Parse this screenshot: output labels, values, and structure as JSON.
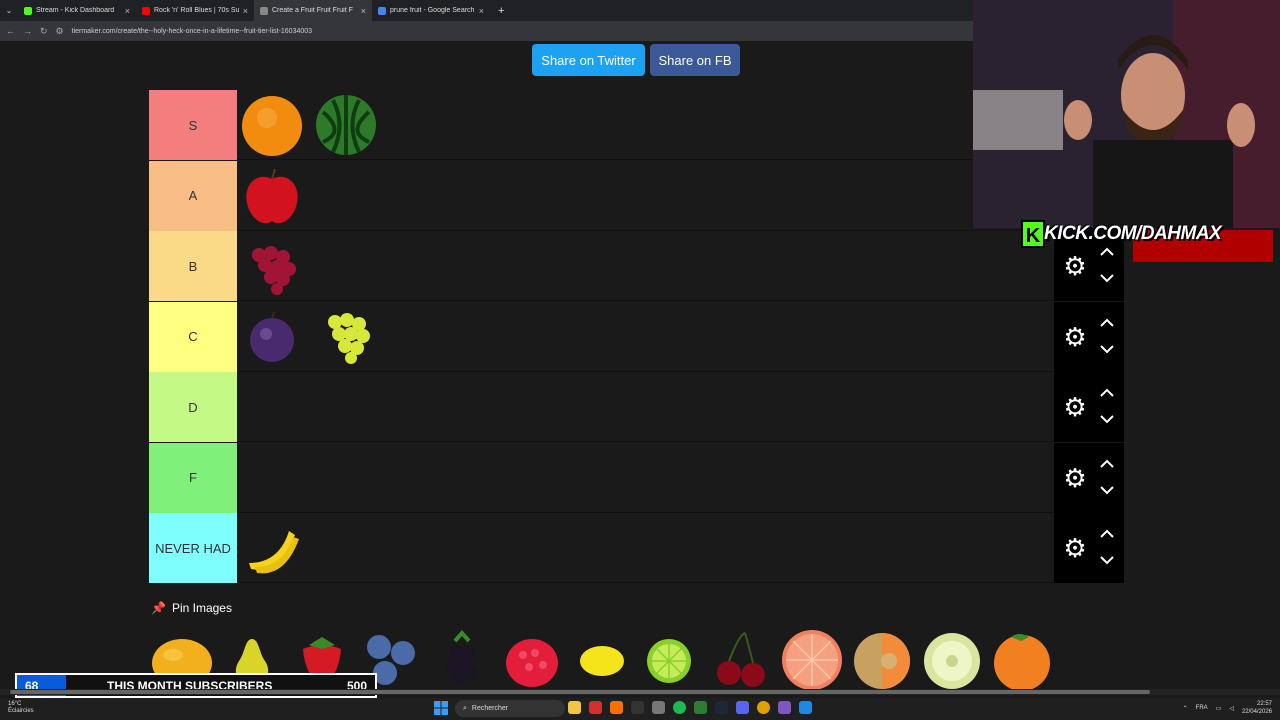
{
  "browser": {
    "tabs": [
      {
        "title": "Stream - Kick Dashboard",
        "color": "#53fc18",
        "active": false
      },
      {
        "title": "Rock 'n' Roll Blues | 70s Sun",
        "color": "#ff0000",
        "active": false
      },
      {
        "title": "Create a Fruit Fruit Fruit F",
        "color": "#888888",
        "active": true
      },
      {
        "title": "prune fruit - Google Search",
        "color": "#4285f4",
        "active": false
      }
    ],
    "url": "tiermaker.com/create/the--holy-heck-once-in-a-lifetime--fruit-tier-list-16034003"
  },
  "share": {
    "twitter": "Share on Twitter",
    "fb": "Share on FB"
  },
  "tiers": [
    {
      "label": "S",
      "color": "#f47e7e",
      "items": [
        "orange",
        "watermelon"
      ]
    },
    {
      "label": "A",
      "color": "#f8be86",
      "items": [
        "apple"
      ]
    },
    {
      "label": "B",
      "color": "#fad987",
      "items": [
        "red-grapes"
      ]
    },
    {
      "label": "C",
      "color": "#fefe81",
      "items": [
        "plum",
        "green-grapes"
      ]
    },
    {
      "label": "D",
      "color": "#c4f986",
      "items": []
    },
    {
      "label": "F",
      "color": "#7ff17b",
      "items": []
    },
    {
      "label": "NEVER HAD",
      "color": "#7ffefe",
      "items": [
        "banana"
      ]
    }
  ],
  "pin_label": "Pin Images",
  "pool": [
    "mango",
    "pear",
    "strawberry",
    "blueberries",
    "blackberry",
    "raspberry",
    "lemon",
    "lime",
    "cherries",
    "grapefruit",
    "cantaloupe",
    "honeydew",
    "tangerine"
  ],
  "stream": {
    "kick_text": "KICK.COM/DAHMAX"
  },
  "subs": {
    "current": "68",
    "label": "THIS MONTH SUBSCRIBERS",
    "goal": "500",
    "progress": 0.136
  },
  "taskbar": {
    "search": "Rechercher",
    "weather_temp": "16°C",
    "weather_desc": "Éclaircies",
    "lang": "FRA",
    "time": "22:57",
    "date": "22/04/2026"
  }
}
